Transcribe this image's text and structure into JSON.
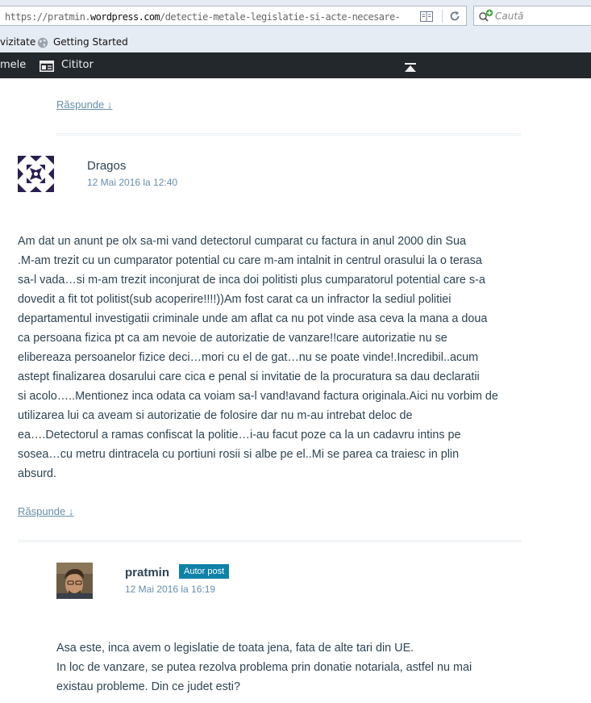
{
  "browser": {
    "url_prefix": "https://pratmin.",
    "url_domain": "wordpress.com",
    "url_path": "/detectie-metale-legislatie-si-acte-necesare-autorizarii-unui-c",
    "search_placeholder": "Caută",
    "bookmarks": [
      {
        "label": "vizitate"
      },
      {
        "label": "Getting Started",
        "icon": "globe-icon"
      }
    ]
  },
  "adminbar": {
    "items": [
      {
        "label": "mele"
      },
      {
        "label": "Cititor",
        "icon": "reader-icon"
      }
    ],
    "scroll_top_icon": "arrow-up-icon"
  },
  "colors": {
    "accent": "#668eaa",
    "text": "#2e4453",
    "badge": "#0e82a8",
    "adminbar": "#23282d"
  },
  "comments": [
    {
      "reply_label": "Răspunde ↓"
    },
    {
      "author": "Dragos",
      "date": "12 Mai 2016 la 12:40",
      "lines": [
        "Am dat un anunt pe olx sa-mi vand detectorul cumparat cu factura in anul 2000 din Sua",
        ".M-am trezit cu un cumparator potential cu care m-am intalnit in centrul orasului la o terasa",
        "sa-l vada…si m-am trezit inconjurat de inca doi politisti plus cumparatorul potential care s-a",
        "dovedit a fit tot politist(sub acoperire!!!!))Am fost carat ca un infractor la sediul politiei",
        "departamentul investigatii criminale unde am aflat ca nu pot vinde asa ceva la mana a doua",
        "ca persoana fizica pt ca am nevoie de autorizatie de vanzare!!care autorizatie nu se",
        "elibereaza persoanelor fizice deci…mori cu el de gat…nu se poate vinde!.Incredibil..acum",
        "astept finalizarea dosarului care cica e penal si invitatie de la procuratura sa dau declaratii",
        "si acolo…..Mentionez inca odata ca voiam sa-l vand!avand factura originala.Aici nu vorbim de",
        "utilizarea lui ca aveam si autorizatie de folosire dar nu m-au intrebat deloc de",
        "ea….Detectorul a ramas confiscat la politie…i-au facut poze ca la un cadavru intins pe",
        "sosea…cu metru dintracela cu portiuni rosii si albe pe el..Mi se parea ca traiesc in plin",
        "absurd."
      ],
      "reply_label": "Răspunde ↓"
    },
    {
      "author": "pratmin",
      "badge": "Autor post",
      "date": "12 Mai 2016 la 16:19",
      "lines": [
        "Asa este, inca avem o legislatie de toata jena, fata de alte tari din UE.",
        "In loc de vanzare, se putea rezolva problema prin donatie notariala, astfel nu mai",
        "existau probleme. Din ce judet esti?"
      ]
    }
  ]
}
